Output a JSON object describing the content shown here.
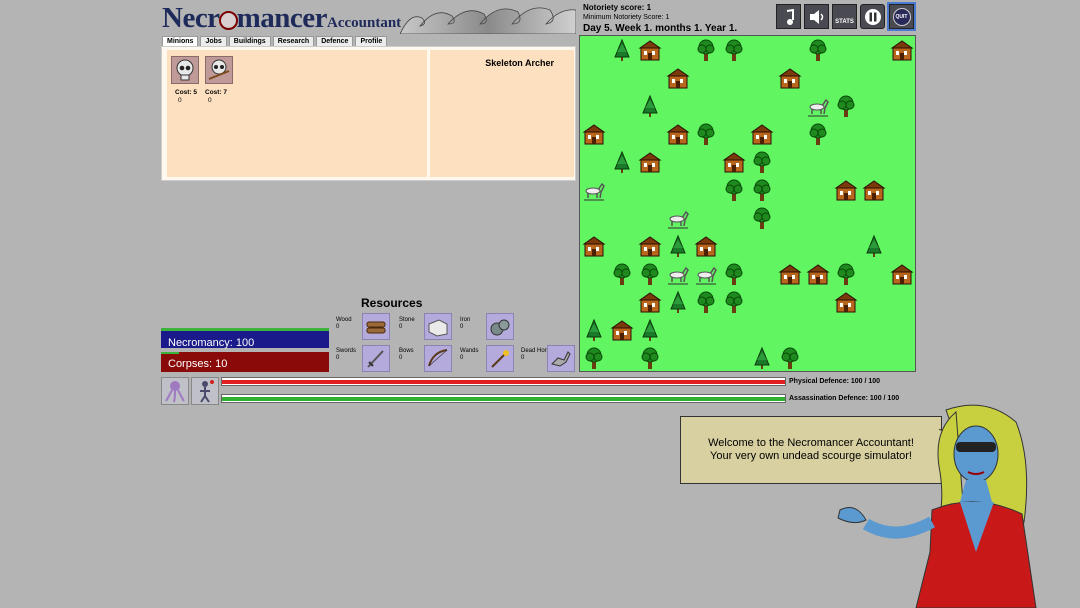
{
  "title": {
    "part1": "Necr",
    "part2": "mancer",
    "subtitle": "Accountant"
  },
  "tabs": [
    "Minions",
    "Jobs",
    "Buildings",
    "Research",
    "Defence",
    "Profile"
  ],
  "minions": [
    {
      "cost_label": "Cost: 5",
      "cost_value": "0"
    },
    {
      "cost_label": "Cost: 7",
      "cost_value": "0"
    }
  ],
  "selected_minion": "Skeleton Archer",
  "status": {
    "notoriety": "Notoriety score: 1",
    "min_notoriety": "Minimum Notoriety Score: 1",
    "date": "Day 5. Week 1. months 1. Year 1."
  },
  "buttons": {
    "stats": "STATS",
    "quit": "QUIT"
  },
  "resources": {
    "title": "Resources",
    "items": [
      {
        "name": "Wood",
        "value": "0"
      },
      {
        "name": "Stone",
        "value": "0"
      },
      {
        "name": "Iron",
        "value": "0"
      },
      {
        "name": "Swords",
        "value": "0"
      },
      {
        "name": "Bows",
        "value": "0"
      },
      {
        "name": "Wands",
        "value": "0"
      },
      {
        "name": "Dead Horses",
        "value": "0"
      }
    ]
  },
  "stats": {
    "necromancy": "Necromancy: 100",
    "corpses": "Corpses: 10"
  },
  "defence": {
    "physical": "Physical Defence: 100 / 100",
    "assassination": "Assassination Defence: 100 / 100",
    "physical_fraction": 1.0,
    "assassination_fraction": 1.0
  },
  "speech": {
    "line1": "Welcome to the Necromancer Accountant!",
    "line2": "Your very own undead scourge simulator!"
  },
  "map_entities": [
    {
      "t": "pine",
      "c": 1,
      "r": 0
    },
    {
      "t": "house",
      "c": 2,
      "r": 0
    },
    {
      "t": "tree",
      "c": 4,
      "r": 0
    },
    {
      "t": "tree",
      "c": 5,
      "r": 0
    },
    {
      "t": "tree",
      "c": 8,
      "r": 0
    },
    {
      "t": "house",
      "c": 11,
      "r": 0
    },
    {
      "t": "house",
      "c": 3,
      "r": 1
    },
    {
      "t": "house",
      "c": 7,
      "r": 1
    },
    {
      "t": "pine",
      "c": 2,
      "r": 2
    },
    {
      "t": "horse",
      "c": 8,
      "r": 2
    },
    {
      "t": "tree",
      "c": 9,
      "r": 2
    },
    {
      "t": "house",
      "c": 0,
      "r": 3
    },
    {
      "t": "house",
      "c": 3,
      "r": 3
    },
    {
      "t": "tree",
      "c": 4,
      "r": 3
    },
    {
      "t": "house",
      "c": 6,
      "r": 3
    },
    {
      "t": "tree",
      "c": 8,
      "r": 3
    },
    {
      "t": "pine",
      "c": 1,
      "r": 4
    },
    {
      "t": "house",
      "c": 2,
      "r": 4
    },
    {
      "t": "house",
      "c": 5,
      "r": 4
    },
    {
      "t": "tree",
      "c": 6,
      "r": 4
    },
    {
      "t": "horse",
      "c": 0,
      "r": 5
    },
    {
      "t": "tree",
      "c": 5,
      "r": 5
    },
    {
      "t": "tree",
      "c": 6,
      "r": 5
    },
    {
      "t": "house",
      "c": 9,
      "r": 5
    },
    {
      "t": "house",
      "c": 10,
      "r": 5
    },
    {
      "t": "horse",
      "c": 3,
      "r": 6
    },
    {
      "t": "tree",
      "c": 6,
      "r": 6
    },
    {
      "t": "house",
      "c": 0,
      "r": 7
    },
    {
      "t": "house",
      "c": 2,
      "r": 7
    },
    {
      "t": "pine",
      "c": 3,
      "r": 7
    },
    {
      "t": "house",
      "c": 4,
      "r": 7
    },
    {
      "t": "pine",
      "c": 10,
      "r": 7
    },
    {
      "t": "tree",
      "c": 1,
      "r": 8
    },
    {
      "t": "tree",
      "c": 2,
      "r": 8
    },
    {
      "t": "horse",
      "c": 3,
      "r": 8
    },
    {
      "t": "horse",
      "c": 4,
      "r": 8
    },
    {
      "t": "tree",
      "c": 5,
      "r": 8
    },
    {
      "t": "house",
      "c": 7,
      "r": 8
    },
    {
      "t": "house",
      "c": 8,
      "r": 8
    },
    {
      "t": "tree",
      "c": 9,
      "r": 8
    },
    {
      "t": "house",
      "c": 11,
      "r": 8
    },
    {
      "t": "house",
      "c": 2,
      "r": 9
    },
    {
      "t": "pine",
      "c": 3,
      "r": 9
    },
    {
      "t": "tree",
      "c": 4,
      "r": 9
    },
    {
      "t": "tree",
      "c": 5,
      "r": 9
    },
    {
      "t": "house",
      "c": 9,
      "r": 9
    },
    {
      "t": "pine",
      "c": 0,
      "r": 10
    },
    {
      "t": "house",
      "c": 1,
      "r": 10
    },
    {
      "t": "pine",
      "c": 2,
      "r": 10
    },
    {
      "t": "tree",
      "c": 0,
      "r": 11
    },
    {
      "t": "tree",
      "c": 2,
      "r": 11
    },
    {
      "t": "pine",
      "c": 6,
      "r": 11
    },
    {
      "t": "tree",
      "c": 7,
      "r": 11
    }
  ]
}
